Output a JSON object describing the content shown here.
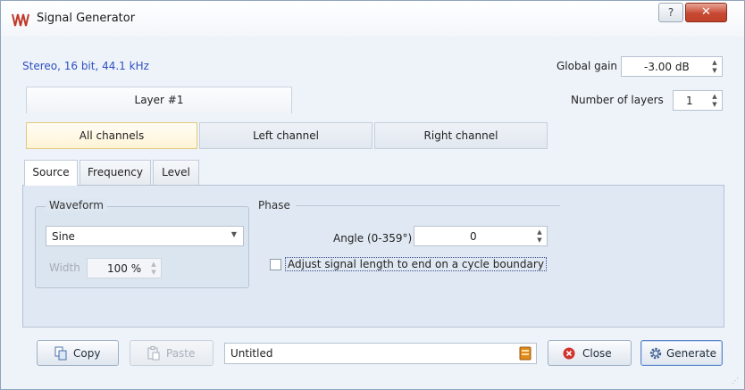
{
  "window": {
    "title": "Signal Generator",
    "help_label": "?",
    "close_label": "✕"
  },
  "header": {
    "format": "Stereo, 16 bit, 44.1 kHz",
    "global_gain_label": "Global gain",
    "global_gain_value": "-3.00 dB",
    "layers_label": "Number of layers",
    "layers_value": "1"
  },
  "layer_tabs": [
    {
      "label": "Layer #1"
    }
  ],
  "channel_tabs": [
    {
      "label": "All channels",
      "active": true
    },
    {
      "label": "Left channel",
      "active": false
    },
    {
      "label": "Right channel",
      "active": false
    }
  ],
  "sub_tabs": [
    {
      "label": "Source",
      "active": true
    },
    {
      "label": "Frequency",
      "active": false
    },
    {
      "label": "Level",
      "active": false
    }
  ],
  "waveform": {
    "group_label": "Waveform",
    "selected": "Sine",
    "width_label": "Width",
    "width_value": "100 %"
  },
  "phase": {
    "group_label": "Phase",
    "angle_label": "Angle (0-359°)",
    "angle_value": "0",
    "adjust_label": "Adjust signal length to end on a cycle boundary",
    "adjust_checked": false
  },
  "footer": {
    "copy_label": "Copy",
    "paste_label": "Paste",
    "name_value": "Untitled",
    "close_label": "Close",
    "generate_label": "Generate"
  },
  "icons": {
    "app": "waveform-icon",
    "copy": "copy-icon",
    "paste": "paste-icon",
    "browse": "book-icon",
    "close": "close-circle-icon",
    "generate": "gear-icon"
  },
  "colors": {
    "format_text": "#2f4fbf",
    "active_tab": "#fff4d6",
    "close_icon": "#d0342c",
    "browse_icon": "#e08a1e"
  }
}
